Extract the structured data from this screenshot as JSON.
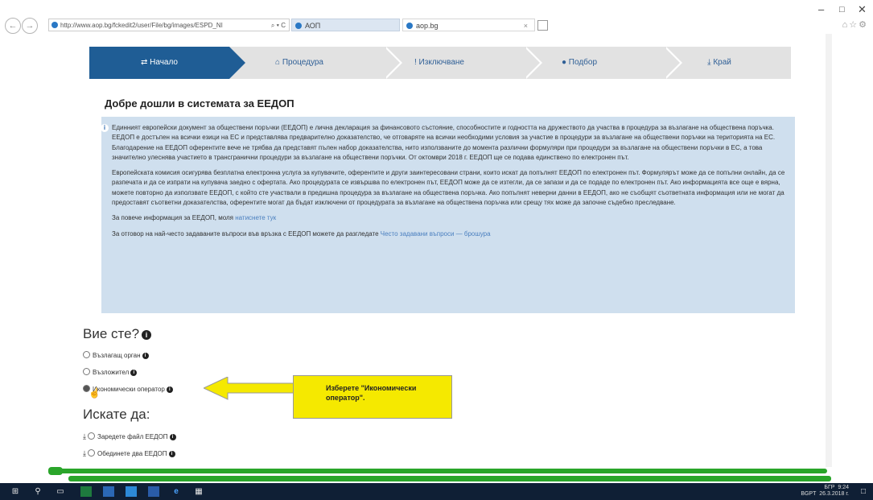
{
  "browser": {
    "url": "http://www.aop.bg/fckedit2/user/File/bg/images/ESPD_NI",
    "search_glyph": "⌕ ▾ C",
    "tabs": [
      {
        "label": "АОП"
      },
      {
        "label": "aop.bg"
      }
    ],
    "close_glyph": "×"
  },
  "wizard": {
    "steps": [
      {
        "label": "⇄ Начало"
      },
      {
        "label": "⌂ Процедура"
      },
      {
        "label": "! Изключване"
      },
      {
        "label": "● Подбор"
      },
      {
        "label": "⤓ Край"
      }
    ]
  },
  "page": {
    "title": "Добре дошли в системата за ЕЕДОП",
    "info_p1": "Единният европейски документ за обществени поръчки (ЕЕДОП) е лична декларация за финансовото състояние, способностите и годността на дружеството да участва в процедура за възлагане на обществена поръчка. ЕЕДОП е достъпен на всички езици на ЕС и представлява предварително доказателство, че отговаряте на всички необходими условия за участие в процедури за възлагане на обществени поръчки на територията на ЕС. Благодарение на ЕЕДОП оферентите вече не трябва да представят пълен набор доказателства, нито използваните до момента различни формуляри при процедури за възлагане на обществени поръчки в ЕС, а това значително улеснява участието в трансгранични процедури за възлагане на обществени поръчки. От октомври 2018 г. ЕЕДОП ще се подава единствено по електронен път.",
    "info_p2": "Европейската комисия осигурява безплатна електронна услуга за купувачите, оферентите и други заинтересовани страни, които искат да попълнят ЕЕДОП по електронен път. Формулярът може да се попълни онлайн, да се разпечата и да се изпрати на купувача заедно с офертата. Ако процедурата се извършва по електронен път, ЕЕДОП може да се изтегли, да се запази и да се подаде по електронен път. Ако информацията все още е вярна, можете повторно да използвате ЕЕДОП, с който сте участвали в предишна процедура за възлагане на обществена поръчка. Ако попълнят неверни данни в ЕЕДОП, ако не съобщят съответната информация или не могат да предоставят съответни доказателства, оферентите могат да бъдат изключени от процедурата за възлагане на обществена поръчка или срещу тях може да започне съдебно преследване.",
    "more_info_text": "За повече информация за ЕЕДОП, моля ",
    "more_info_link": "натиснете тук",
    "faq_text": "За отговор на най-често задаваните въпроси във връзка с ЕЕДОП можете да разгледате ",
    "faq_link": "Често задавани въпроси — брошура",
    "who_heading": "Вие сте?",
    "who_options": [
      {
        "label": "Възлагащ орган",
        "selected": false
      },
      {
        "label": "Възложител",
        "selected": false
      },
      {
        "label": "Икономически оператор",
        "selected": true
      }
    ],
    "want_heading": "Искате да:",
    "want_options": [
      {
        "label": "Заредете файл ЕЕДОП",
        "selected": false
      },
      {
        "label": "Обединете два ЕЕДОП",
        "selected": false
      }
    ],
    "info_glyph": "i",
    "download_glyph": "⤓"
  },
  "callout": {
    "text": "Изберете \"Икономически оператор\".",
    "color": "#f5e900"
  },
  "taskbar": {
    "lang": "БГР",
    "lang_sub": "BGPT",
    "time": "9:24",
    "date": "26.3.2018 г.",
    "icons": [
      "windows-icon",
      "search-icon",
      "task-view-icon",
      "excel-icon",
      "outlook-icon",
      "explorer-icon",
      "word-icon",
      "ie-icon",
      "calculator-icon"
    ]
  },
  "colors": {
    "accent": "#1f5d95",
    "info_bg": "#cfdfee",
    "progress": "#2aa52a"
  }
}
